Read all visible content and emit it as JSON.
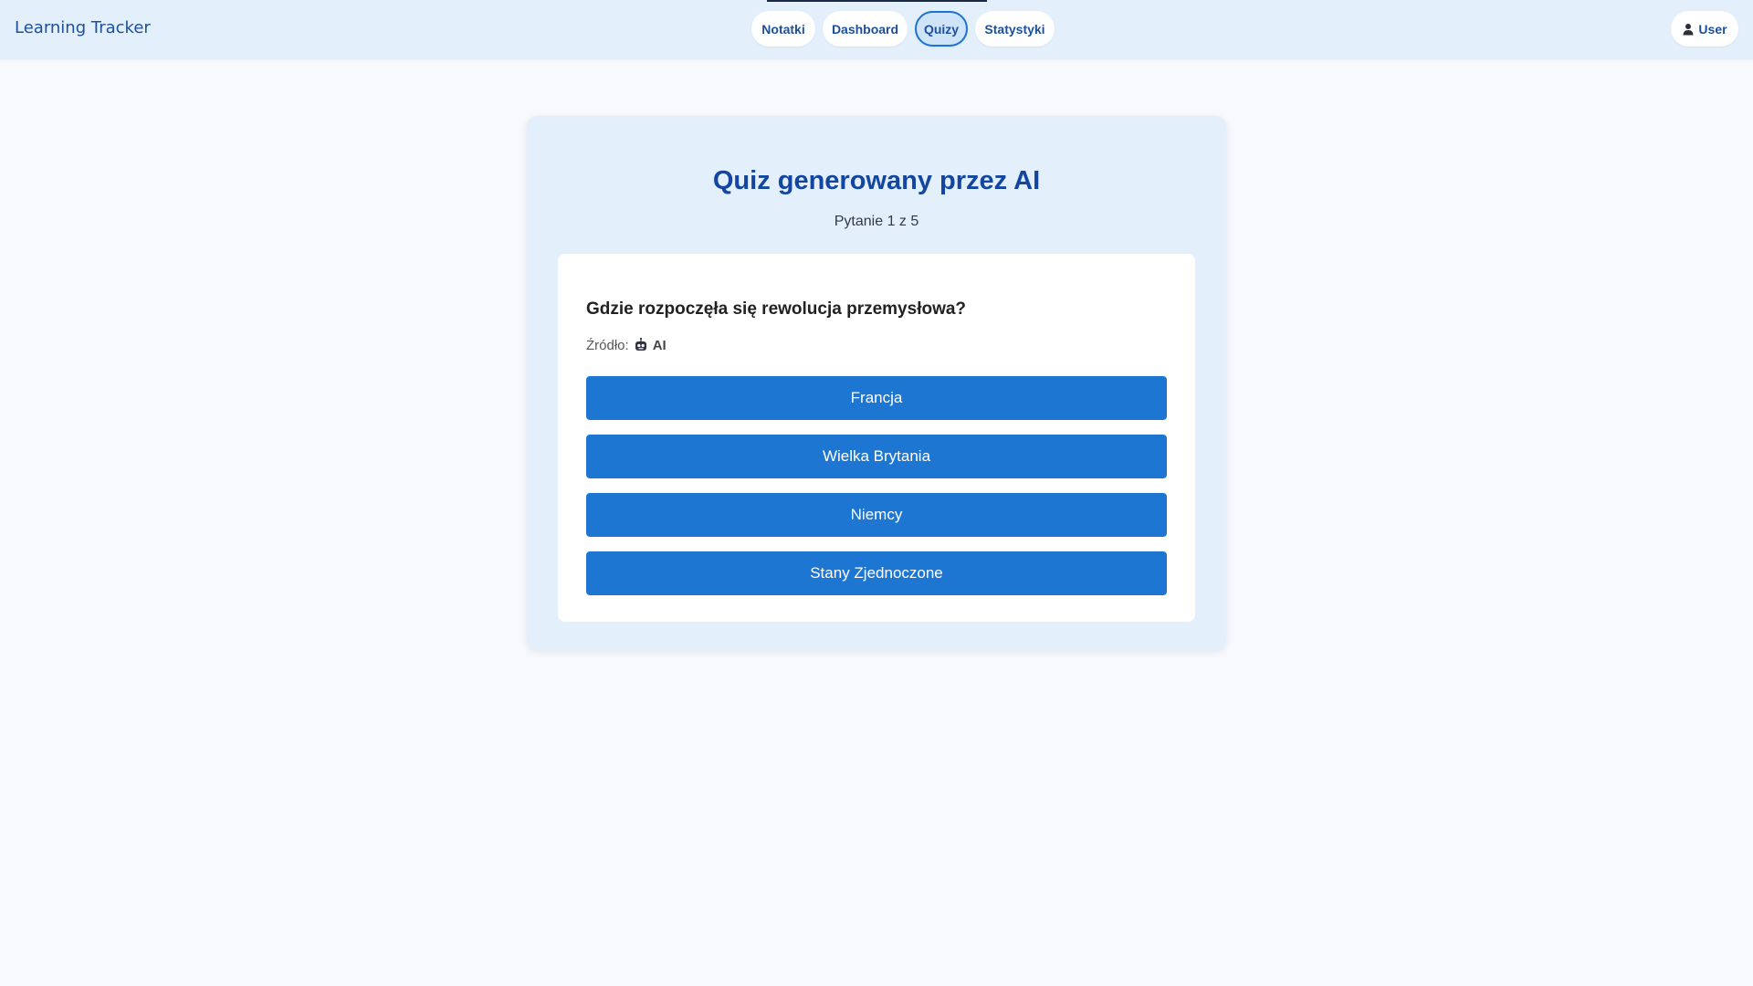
{
  "app": {
    "brand": "Learning Tracker"
  },
  "nav": {
    "items": [
      {
        "label": "Notatki"
      },
      {
        "label": "Dashboard"
      },
      {
        "label": "Quizy"
      },
      {
        "label": "Statystyki"
      }
    ],
    "active": "Quizy"
  },
  "user": {
    "label": "User",
    "icon": "user-icon"
  },
  "quiz": {
    "title": "Quiz generowany przez AI",
    "progress": "Pytanie 1 z 5",
    "question": "Gdzie rozpoczęła się rewolucja przemysłowa?",
    "source_label": "Źródło:",
    "source_icon": "robot-icon",
    "source_value": "AI",
    "answers": [
      {
        "label": "Francja"
      },
      {
        "label": "Wielka Brytania"
      },
      {
        "label": "Niemcy"
      },
      {
        "label": "Stany Zjednoczone"
      }
    ]
  },
  "colors": {
    "accent": "#1c76d2",
    "header_bg": "#e3f0fb",
    "title": "#1246a0"
  }
}
